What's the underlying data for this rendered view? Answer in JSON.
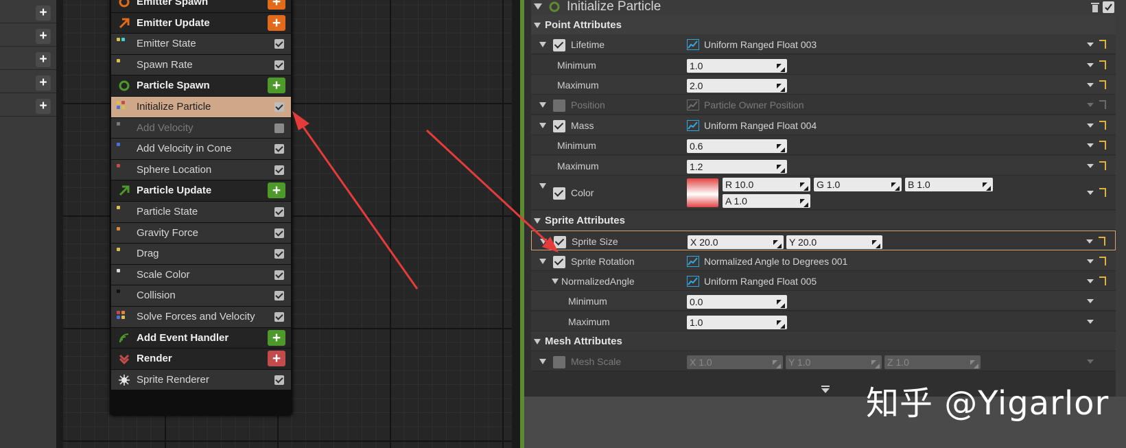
{
  "colors": {
    "accent_orange": "#e26a1b",
    "accent_green": "#4d9a2a",
    "accent_red": "#c44b4b",
    "selected_row": "#cfa88a",
    "emitter_green_bar": "#5f8b2e",
    "highlight_border": "#d6a675",
    "arrow_red": "#e53b3b",
    "curve_icon": "#33a6e0",
    "reset_yellow": "#e0b43a"
  },
  "emitter_node": {
    "items": [
      {
        "label": "Emitter Spawn",
        "kind": "section",
        "icon": "emitter-spawn-icon",
        "color": "#e26a1b",
        "add": true
      },
      {
        "label": "Emitter Update",
        "kind": "section",
        "icon": "emitter-update-icon",
        "color": "#e26a1b",
        "add": true
      },
      {
        "label": "Emitter State",
        "kind": "module",
        "enabled": true,
        "dots": [
          "#d8c24a",
          "#3ad6d6"
        ]
      },
      {
        "label": "Spawn Rate",
        "kind": "module",
        "enabled": true,
        "dots": [
          "#d8c24a"
        ]
      },
      {
        "label": "Particle Spawn",
        "kind": "section",
        "icon": "particle-spawn-icon",
        "color": "#4d9a2a",
        "add": true
      },
      {
        "label": "Initialize Particle",
        "kind": "module",
        "enabled": true,
        "selected": true,
        "dots": [
          "#d8c24a",
          "#c44b4b",
          "#4b6fd6",
          "#d8c24a"
        ]
      },
      {
        "label": "Add Velocity",
        "kind": "module",
        "enabled": false,
        "dim": true,
        "dots": [
          "#7a7a7a"
        ]
      },
      {
        "label": "Add Velocity in Cone",
        "kind": "module",
        "enabled": true,
        "dots": [
          "#4b6fd6"
        ]
      },
      {
        "label": "Sphere Location",
        "kind": "module",
        "enabled": true,
        "dots": [
          "#c44b4b"
        ]
      },
      {
        "label": "Particle Update",
        "kind": "section",
        "icon": "particle-update-icon",
        "color": "#4d9a2a",
        "add": true
      },
      {
        "label": "Particle State",
        "kind": "module",
        "enabled": true,
        "dots": [
          "#d8c24a"
        ]
      },
      {
        "label": "Gravity Force",
        "kind": "module",
        "enabled": true,
        "dots": [
          "#e0883a"
        ]
      },
      {
        "label": "Drag",
        "kind": "module",
        "enabled": true,
        "dots": [
          "#d8c24a"
        ]
      },
      {
        "label": "Scale Color",
        "kind": "module",
        "enabled": true,
        "dots": [
          "#d8d8d8"
        ]
      },
      {
        "label": "Collision",
        "kind": "module",
        "enabled": true,
        "dots": [
          "#111111"
        ]
      },
      {
        "label": "Solve Forces and Velocity",
        "kind": "module",
        "enabled": true,
        "dots": [
          "#c44b4b",
          "#e0883a",
          "#4b6fd6",
          "#d8c24a"
        ]
      },
      {
        "label": "Add Event Handler",
        "kind": "section",
        "icon": "event-handler-icon",
        "color": "#4d9a2a",
        "add": true
      },
      {
        "label": "Render",
        "kind": "section",
        "icon": "render-icon",
        "color": "#c44b4b",
        "add": true
      },
      {
        "label": "Sprite Renderer",
        "kind": "module",
        "enabled": true,
        "icon": "sprite-renderer-icon"
      }
    ]
  },
  "details": {
    "title": "Initialize Particle",
    "rows": [
      {
        "type": "category",
        "label": "Point Attributes",
        "indent": 0
      },
      {
        "type": "prop",
        "label": "Lifetime",
        "indent": 1,
        "check": true,
        "value": {
          "kind": "curve",
          "text": "Uniform Ranged Float 003"
        }
      },
      {
        "type": "prop",
        "label": "Minimum",
        "indent": 2,
        "value": {
          "kind": "num",
          "fields": [
            "1.0"
          ]
        }
      },
      {
        "type": "prop",
        "label": "Maximum",
        "indent": 2,
        "value": {
          "kind": "num",
          "fields": [
            "2.0"
          ]
        }
      },
      {
        "type": "prop",
        "label": "Position",
        "indent": 1,
        "check": false,
        "dim": true,
        "value": {
          "kind": "curve",
          "text": "Particle Owner Position"
        }
      },
      {
        "type": "prop",
        "label": "Mass",
        "indent": 1,
        "check": true,
        "value": {
          "kind": "curve",
          "text": "Uniform Ranged Float 004"
        }
      },
      {
        "type": "prop",
        "label": "Minimum",
        "indent": 2,
        "value": {
          "kind": "num",
          "fields": [
            "0.6"
          ]
        }
      },
      {
        "type": "prop",
        "label": "Maximum",
        "indent": 2,
        "value": {
          "kind": "num",
          "fields": [
            "1.2"
          ]
        }
      },
      {
        "type": "color",
        "label": "Color",
        "indent": 1,
        "check": true,
        "value": {
          "kind": "color",
          "fields": [
            "R 10.0",
            "G 1.0",
            "B 1.0",
            "A 1.0"
          ]
        }
      },
      {
        "type": "category",
        "label": "Sprite Attributes",
        "indent": 0
      },
      {
        "type": "prop",
        "label": "Sprite Size",
        "indent": 1,
        "check": true,
        "hilite": true,
        "value": {
          "kind": "num",
          "fields": [
            "X 20.0",
            "Y 20.0"
          ]
        }
      },
      {
        "type": "prop",
        "label": "Sprite Rotation",
        "indent": 1,
        "check": true,
        "value": {
          "kind": "curve",
          "text": "Normalized Angle to Degrees 001"
        }
      },
      {
        "type": "prop",
        "label": "NormalizedAngle",
        "indent": 2,
        "expand": true,
        "value": {
          "kind": "curve",
          "text": "Uniform Ranged Float 005"
        }
      },
      {
        "type": "prop",
        "label": "Minimum",
        "indent": 3,
        "noreset": true,
        "value": {
          "kind": "num",
          "fields": [
            "0.0"
          ]
        }
      },
      {
        "type": "prop",
        "label": "Maximum",
        "indent": 3,
        "noreset": true,
        "value": {
          "kind": "num",
          "fields": [
            "1.0"
          ]
        }
      },
      {
        "type": "category",
        "label": "Mesh Attributes",
        "indent": 0
      },
      {
        "type": "prop",
        "label": "Mesh Scale",
        "indent": 1,
        "check": false,
        "dim": true,
        "noreset": true,
        "value": {
          "kind": "num",
          "fields": [
            "X 1.0",
            "Y 1.0",
            "Z 1.0"
          ]
        }
      }
    ]
  },
  "watermark": "知乎 @Yigarlor"
}
